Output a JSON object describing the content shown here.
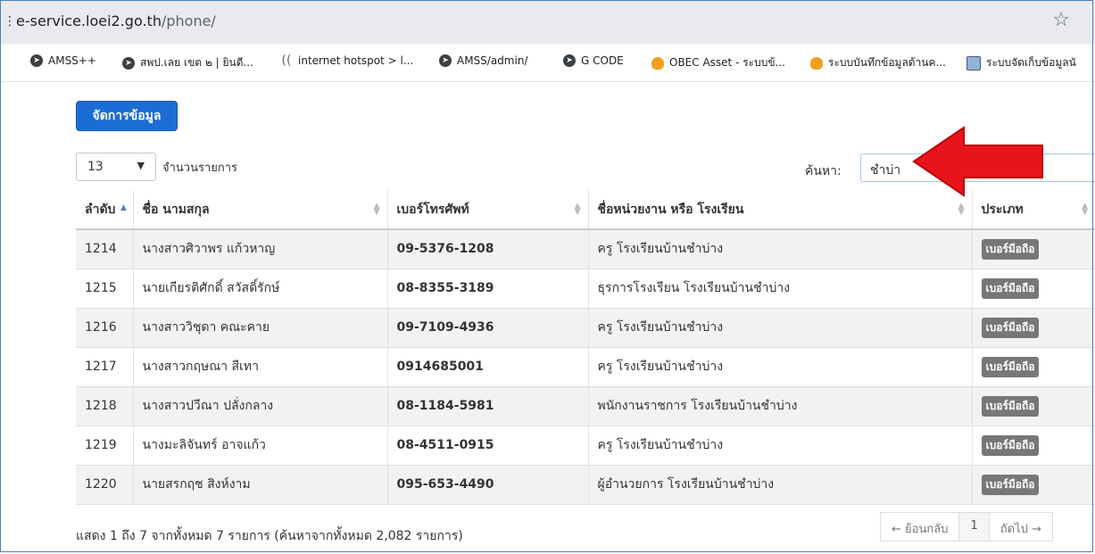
{
  "browser": {
    "url_domain": "e-service.loei2.go.th",
    "url_path": "/phone/",
    "bookmarks": [
      {
        "label": "AMSS++",
        "icon": "globe-icon"
      },
      {
        "label": "สพป.เลย เขต ๒ | ยินดี...",
        "icon": "globe-icon"
      },
      {
        "label": "internet hotspot > l...",
        "icon": "wifi-icon"
      },
      {
        "label": "AMSS/admin/",
        "icon": "globe-icon"
      },
      {
        "label": "G CODE",
        "icon": "globe-icon"
      },
      {
        "label": "OBEC Asset - ระบบข้...",
        "icon": "flame-icon"
      },
      {
        "label": "ระบบบันทึกข้อมูลด้านค...",
        "icon": "flame-icon"
      },
      {
        "label": "ระบบจัดเก็บข้อมูลนั",
        "icon": "image-icon"
      }
    ]
  },
  "toolbar": {
    "manage_label": "จัดการข้อมูล"
  },
  "controls": {
    "length_value": "13",
    "length_label": "จำนวนรายการ",
    "search_label": "ค้นหา:",
    "search_value": "ชำบ่า"
  },
  "table": {
    "columns": [
      "ลำดับ",
      "ชื่อ นามสกุล",
      "เบอร์โทรศัพท์",
      "ชื่อหน่วยงาน หรือ โรงเรียน",
      "ประเภท"
    ],
    "rows": [
      {
        "no": "1214",
        "name": "นางสาวศิวาพร แก้วหาญ",
        "phone": "09-5376-1208",
        "unit": "ครู โรงเรียนบ้านชำบ่าง",
        "type": "เบอร์มือถือ"
      },
      {
        "no": "1215",
        "name": "นายเกียรติศักดิ์ สวัสดิ์รักษ์",
        "phone": "08-8355-3189",
        "unit": "ธุรการโรงเรียน โรงเรียนบ้านชำบ่าง",
        "type": "เบอร์มือถือ"
      },
      {
        "no": "1216",
        "name": "นางสาววิชุดา คณะคาย",
        "phone": "09-7109-4936",
        "unit": "ครู โรงเรียนบ้านชำบ่าง",
        "type": "เบอร์มือถือ"
      },
      {
        "no": "1217",
        "name": "นางสาวกฤษณา สีเทา",
        "phone": "0914685001",
        "unit": "ครู โรงเรียนบ้านชำบ่าง",
        "type": "เบอร์มือถือ"
      },
      {
        "no": "1218",
        "name": "นางสาวปวีณา ปลั่งกลาง",
        "phone": "08-1184-5981",
        "unit": "พนักงานราชการ โรงเรียนบ้านชำบ่าง",
        "type": "เบอร์มือถือ"
      },
      {
        "no": "1219",
        "name": "นางมะลิจันทร์ อาจแก้ว",
        "phone": "08-4511-0915",
        "unit": "ครู โรงเรียนบ้านชำบ่าง",
        "type": "เบอร์มือถือ"
      },
      {
        "no": "1220",
        "name": "นายสรกฤช สิงห์งาม",
        "phone": "095-653-4490",
        "unit": "ผู้อำนวยการ โรงเรียนบ้านชำบ่าง",
        "type": "เบอร์มือถือ"
      }
    ]
  },
  "footer": {
    "info": "แสดง 1 ถึง 7 จากทั้งหมด 7 รายการ (ค้นหาจากทั้งหมด 2,082 รายการ)",
    "prev_label": "← ย้อนกลับ",
    "page_label": "1",
    "next_label": "ถัดไป →"
  },
  "colors": {
    "accent": "#1c6cd6",
    "arrow": "#e8141c",
    "badge": "#777777"
  }
}
